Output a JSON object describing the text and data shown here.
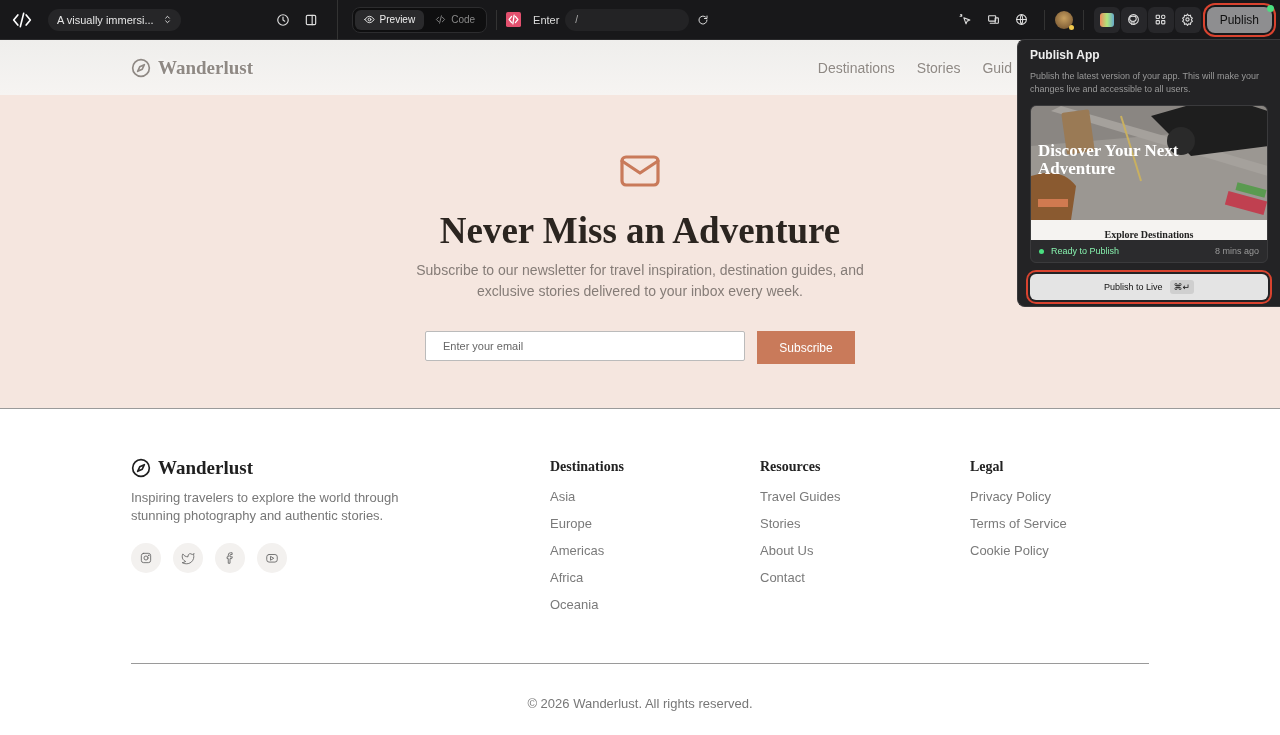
{
  "toolbar": {
    "project_title": "A visually immersi...",
    "view_tabs": [
      {
        "label": "Preview",
        "selected": true
      },
      {
        "label": "Code",
        "selected": false
      }
    ],
    "route_label": "Enter",
    "route_value": "/",
    "publish_button": "Publish"
  },
  "site_header": {
    "brand": "Wanderlust",
    "nav": [
      "Destinations",
      "Stories",
      "Guid"
    ]
  },
  "newsletter": {
    "title": "Never Miss an Adventure",
    "text": "Subscribe to our newsletter for travel inspiration, destination guides, and exclusive stories delivered to your inbox every week.",
    "email_placeholder": "Enter your email",
    "button": "Subscribe"
  },
  "footer": {
    "brand": "Wanderlust",
    "tagline": "Inspiring travelers to explore the world through stunning photography and authentic stories.",
    "columns": [
      {
        "title": "Destinations",
        "links": [
          "Asia",
          "Europe",
          "Americas",
          "Africa",
          "Oceania"
        ]
      },
      {
        "title": "Resources",
        "links": [
          "Travel Guides",
          "Stories",
          "About Us",
          "Contact"
        ]
      },
      {
        "title": "Legal",
        "links": [
          "Privacy Policy",
          "Terms of Service",
          "Cookie Policy"
        ]
      }
    ],
    "copyright": "© 2026 Wanderlust. All rights reserved."
  },
  "publish_popover": {
    "title": "Publish App",
    "description": "Publish the latest version of your app. This will make your changes live and accessible to all users.",
    "preview": {
      "heading": "Discover Your Next Adventure",
      "section_title": "Explore Destinations"
    },
    "status": "Ready to Publish",
    "time": "8 mins ago",
    "button": "Publish to Live",
    "shortcut": "⌘↵"
  }
}
